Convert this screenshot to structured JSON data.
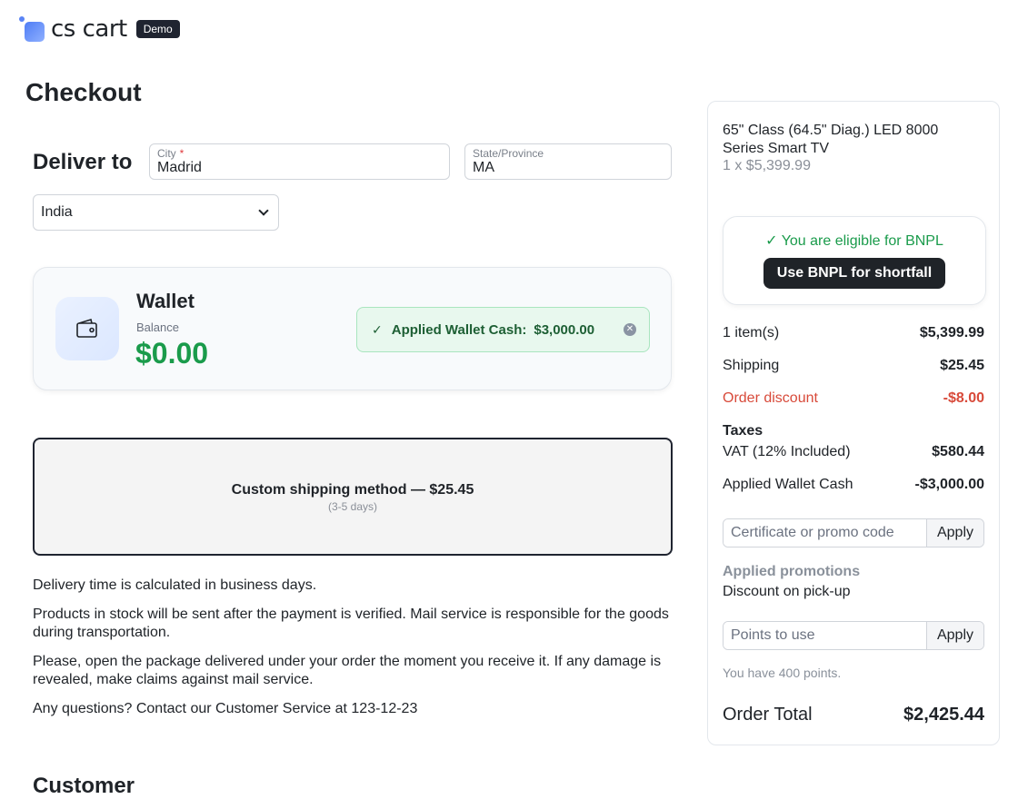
{
  "header": {
    "logo_text": "cs cart",
    "badge": "Demo"
  },
  "page": {
    "title": "Checkout"
  },
  "deliver": {
    "title": "Deliver to",
    "city": {
      "label": "City",
      "required_mark": "*",
      "value": "Madrid"
    },
    "state": {
      "label": "State/Province",
      "value": "MA"
    },
    "country": {
      "selected": "India"
    }
  },
  "wallet": {
    "title": "Wallet",
    "balance_label": "Balance",
    "balance": "$0.00",
    "applied_label": "Applied Wallet Cash:",
    "applied_amount": "$3,000.00",
    "icon": "wallet-icon"
  },
  "shipping": {
    "method": "Custom shipping method — $25.45",
    "days": "(3-5 days)"
  },
  "info": [
    "Delivery time is calculated in business days.",
    "Products in stock will be sent after the payment is verified. Mail service is responsible for the goods during transportation.",
    "Please, open the package delivered under your order the moment you receive it. If any damage is revealed, make claims against mail service.",
    "Any questions? Contact our Customer Service at 123-12-23"
  ],
  "customer": {
    "title": "Customer"
  },
  "summary": {
    "product_name": "65\" Class (64.5\" Diag.) LED 8000 Series Smart TV",
    "product_qty": "1 x $5,399.99",
    "bnpl_eligible": "You are eligible for BNPL",
    "bnpl_button": "Use BNPL for shortfall",
    "items_label": "1 item(s)",
    "items_value": "$5,399.99",
    "shipping_label": "Shipping",
    "shipping_value": "$25.45",
    "discount_label": "Order discount",
    "discount_value": "-$8.00",
    "taxes_label": "Taxes",
    "vat_label": "VAT (12% Included)",
    "vat_value": "$580.44",
    "wallet_label": "Applied Wallet Cash",
    "wallet_value": "-$3,000.00",
    "promo_placeholder": "Certificate or promo code",
    "apply_label": "Apply",
    "promotions_label": "Applied promotions",
    "promotion_item": "Discount on pick-up",
    "points_placeholder": "Points to use",
    "points_info": "You have 400 points.",
    "total_label": "Order Total",
    "total_value": "$2,425.44"
  },
  "colors": {
    "green": "#1a9b4b",
    "discount_red": "#d84a3a",
    "dark": "#1f2328"
  }
}
